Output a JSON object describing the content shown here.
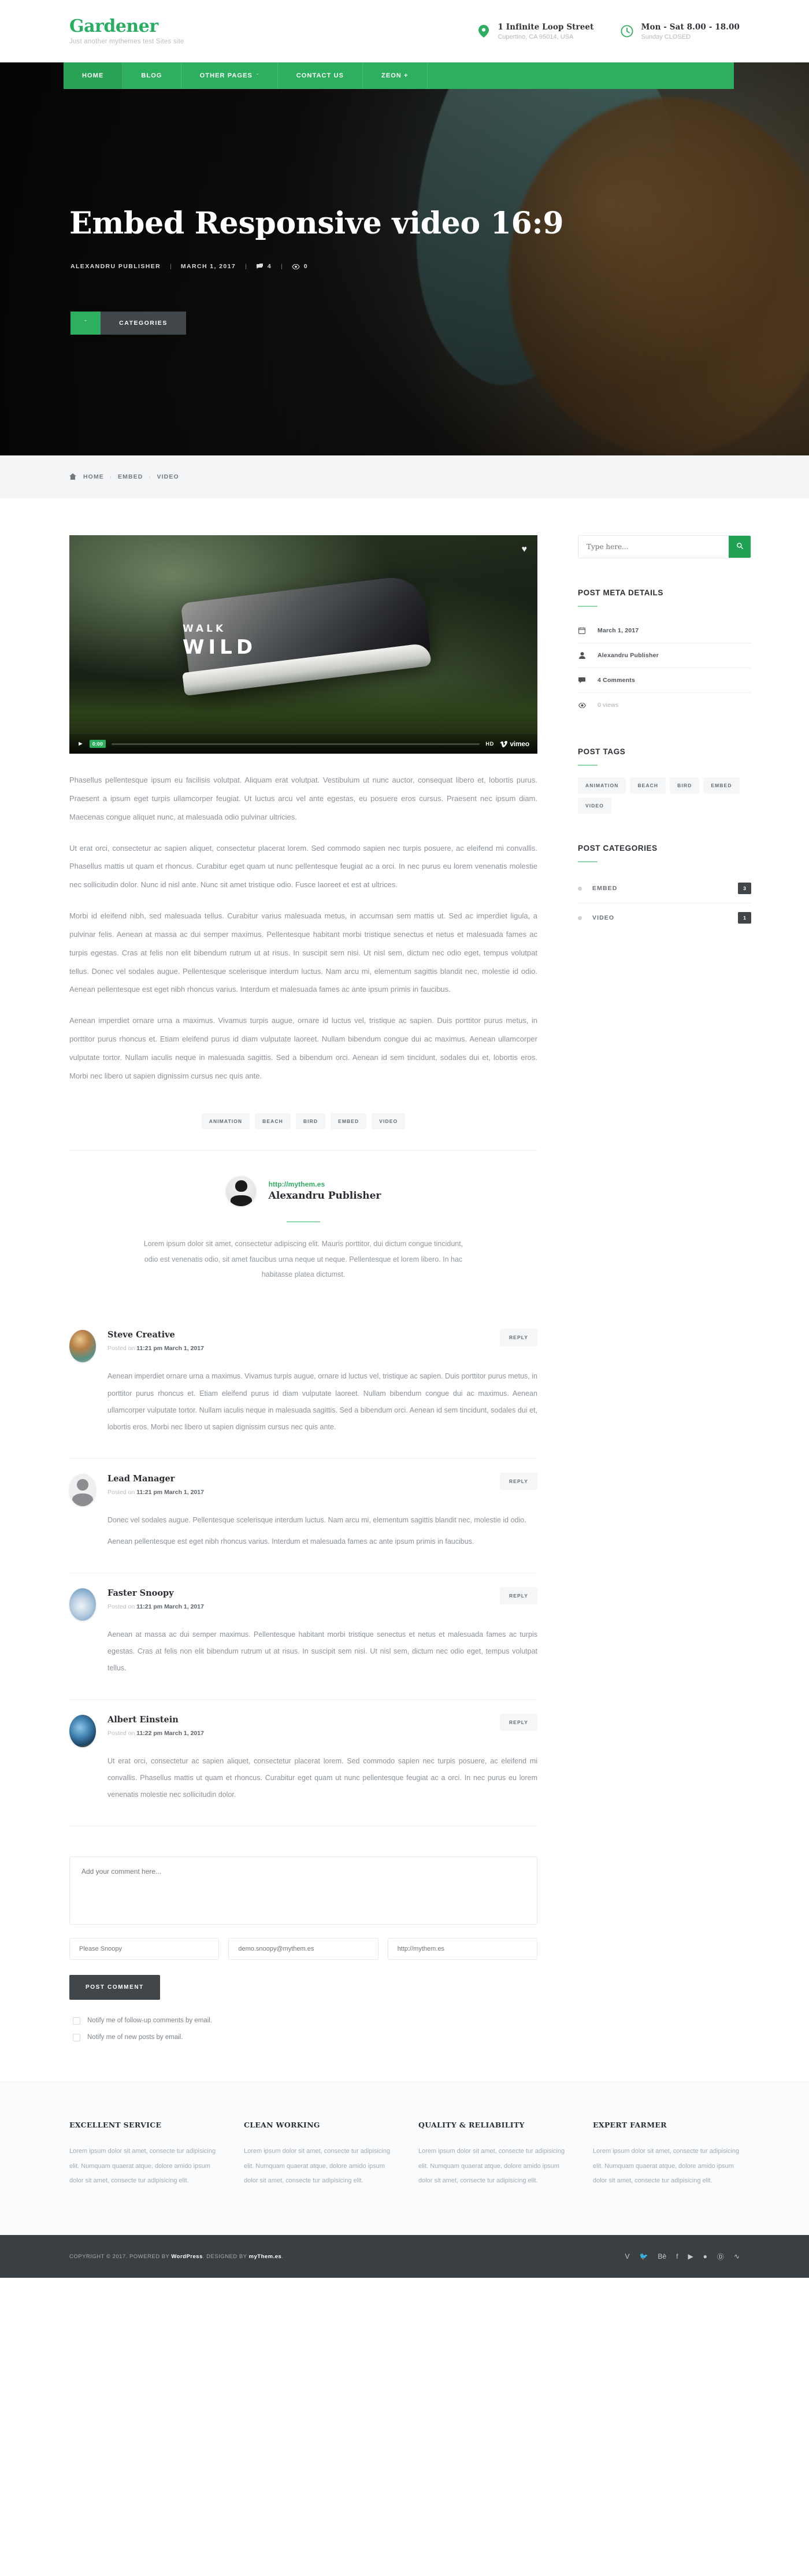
{
  "header": {
    "brand": {
      "title": "Gardener",
      "tagline": "Just another mythemes test Sites site"
    },
    "info": [
      {
        "icon": "location-pin-icon",
        "primary": "1 Infinite Loop Street",
        "secondary": "Cupertino, CA 95014, USA"
      },
      {
        "icon": "clock-icon",
        "primary": "Mon - Sat 8.00 - 18.00",
        "secondary": "Sunday CLOSED"
      }
    ]
  },
  "nav": {
    "items": [
      {
        "label": "HOME",
        "caret": ""
      },
      {
        "label": "BLOG",
        "caret": ""
      },
      {
        "label": "OTHER PAGES",
        "caret": "ˇ"
      },
      {
        "label": "CONTACT US",
        "caret": ""
      },
      {
        "label": "ZEON +",
        "caret": ""
      }
    ]
  },
  "hero": {
    "title": "Embed Responsive video 16:9",
    "meta": {
      "author": "ALEXANDRU PUBLISHER",
      "date": "MARCH 1, 2017",
      "comments": "4",
      "views": "0",
      "separator": "|"
    },
    "categories_button": {
      "label": "CATEGORIES",
      "arrow": "ˇ"
    }
  },
  "breadcrumb": {
    "home": "HOME",
    "items": [
      "EMBED",
      "VIDEO"
    ],
    "chevron": "›"
  },
  "player": {
    "watermark_line1": "WALK",
    "watermark_line2": "WILD",
    "time": "0:00",
    "quality": "HD",
    "provider": "vimeo",
    "play_icon": "play-icon",
    "favorite_icon": "heart-icon"
  },
  "article": {
    "paragraphs": [
      "Phasellus pellentesque ipsum eu facilisis volutpat. Aliquam erat volutpat. Vestibulum ut nunc auctor, consequat libero et, lobortis purus. Praesent a ipsum eget turpis ullamcorper feugiat. Ut luctus arcu vel ante egestas, eu posuere eros cursus. Praesent nec ipsum diam. Maecenas congue aliquet nunc, at malesuada odio pulvinar ultricies.",
      "Ut erat orci, consectetur ac sapien aliquet, consectetur placerat lorem. Sed commodo sapien nec turpis posuere, ac eleifend mi convallis. Phasellus mattis ut quam et rhoncus. Curabitur eget quam ut nunc pellentesque feugiat ac a orci. In nec purus eu lorem venenatis molestie nec sollicitudin dolor. Nunc id nisl ante. Nunc sit amet tristique odio. Fusce laoreet et est at ultrices.",
      "Morbi id eleifend nibh, sed malesuada tellus. Curabitur varius malesuada metus, in accumsan sem mattis ut. Sed ac imperdiet ligula, a pulvinar felis. Aenean at massa ac dui semper maximus. Pellentesque habitant morbi tristique senectus et netus et malesuada fames ac turpis egestas. Cras at felis non elit bibendum rutrum ut at risus. In suscipit sem nisi. Ut nisl sem, dictum nec odio eget, tempus volutpat tellus. Donec vel sodales augue. Pellentesque scelerisque interdum luctus. Nam arcu mi, elementum sagittis blandit nec, molestie id odio. Aenean pellentesque est eget nibh rhoncus varius. Interdum et malesuada fames ac ante ipsum primis in faucibus.",
      "Aenean imperdiet ornare urna a maximus. Vivamus turpis augue, ornare id luctus vel, tristique ac sapien. Duis porttitor purus metus, in porttitor purus rhoncus et. Etiam eleifend purus id diam vulputate laoreet. Nullam bibendum congue dui ac maximus. Aenean ullamcorper vulputate tortor. Nullam iaculis neque in malesuada sagittis. Sed a bibendum orci. Aenean id sem tincidunt, sodales dui et, lobortis eros. Morbi nec libero ut sapien dignissim cursus nec quis ante."
    ],
    "tags": [
      "ANIMATION",
      "BEACH",
      "BIRD",
      "EMBED",
      "VIDEO"
    ]
  },
  "author": {
    "url": "http://mythem.es",
    "name": "Alexandru Publisher",
    "bio": "Lorem ipsum dolor sit amet, consectetur adipiscing elit. Mauris porttitor, dui dictum congue tincidunt, odio est venenatis odio, sit amet faucibus urna neque ut neque. Pellentesque et lorem libero. In hac habitasse platea dictumst."
  },
  "comments": {
    "reply_label": "REPLY",
    "posted_prefix": "Posted on ",
    "items": [
      {
        "name": "Steve Creative",
        "date": "11:21 pm March 1, 2017",
        "avatar": "avatar-steve-creative",
        "paragraphs": [
          "Aenean imperdiet ornare urna a maximus. Vivamus turpis augue, ornare id luctus vel, tristique ac sapien. Duis porttitor purus metus, in porttitor purus rhoncus et. Etiam eleifend purus id diam vulputate laoreet. Nullam bibendum congue dui ac maximus. Aenean ullamcorper vulputate tortor. Nullam iaculis neque in malesuada sagittis. Sed a bibendum orci. Aenean id sem tincidunt, sodales dui et, lobortis eros. Morbi nec libero ut sapien dignissim cursus nec quis ante."
        ]
      },
      {
        "name": "Lead Manager",
        "date": "11:21 pm March 1, 2017",
        "avatar": "avatar-lead-manager",
        "paragraphs": [
          "Donec vel sodales augue. Pellentesque scelerisque interdum luctus. Nam arcu mi, elementum sagittis blandit nec, molestie id odio.",
          "Aenean pellentesque est eget nibh rhoncus varius. Interdum et malesuada fames ac ante ipsum primis in faucibus."
        ]
      },
      {
        "name": "Faster Snoopy",
        "date": "11:21 pm March 1, 2017",
        "avatar": "avatar-faster-snoopy",
        "paragraphs": [
          "Aenean at massa ac dui semper maximus. Pellentesque habitant morbi tristique senectus et netus et malesuada fames ac turpis egestas. Cras at felis non elit bibendum rutrum ut at risus. In suscipit sem nisi. Ut nisl sem, dictum nec odio eget, tempus volutpat tellus."
        ]
      },
      {
        "name": "Albert Einstein",
        "date": "11:22 pm March 1, 2017",
        "avatar": "avatar-albert-einstein",
        "paragraphs": [
          "Ut erat orci, consectetur ac sapien aliquet, consectetur placerat lorem. Sed commodo sapien nec turpis posuere, ac eleifend mi convallis. Phasellus mattis ut quam et rhoncus. Curabitur eget quam ut nunc pellentesque feugiat ac a orci. In nec purus eu lorem venenatis molestie nec sollicitudin dolor."
        ]
      }
    ]
  },
  "comment_form": {
    "comment_placeholder": "Add your comment here...",
    "name_placeholder": "Please Snoopy",
    "email_placeholder": "demo.snoopy@mythem.es",
    "website_placeholder": "http://mythem.es",
    "submit_label": "POST COMMENT",
    "checkbox_followup": "Notify me of follow-up comments by email.",
    "checkbox_newposts": "Notify me of new posts by email."
  },
  "sidebar": {
    "search": {
      "placeholder": "Type here...",
      "icon": "search-icon"
    },
    "post_meta": {
      "title": "POST META DETAILS",
      "items": [
        {
          "icon": "calendar-icon",
          "label": "March 1, 2017",
          "muted": false
        },
        {
          "icon": "user-icon",
          "label": "Alexandru Publisher",
          "muted": false
        },
        {
          "icon": "comment-icon",
          "label": "4 Comments",
          "muted": false
        },
        {
          "icon": "eye-icon",
          "label": "0 views",
          "muted": true
        }
      ]
    },
    "post_tags": {
      "title": "POST TAGS",
      "tags": [
        "ANIMATION",
        "BEACH",
        "BIRD",
        "EMBED",
        "VIDEO"
      ]
    },
    "post_categories": {
      "title": "POST CATEGORIES",
      "items": [
        {
          "name": "EMBED",
          "count": "3"
        },
        {
          "name": "VIDEO",
          "count": "1"
        }
      ]
    }
  },
  "footer": {
    "columns": [
      {
        "title": "EXCELLENT SERVICE",
        "text": "Lorem ipsum dolor sit amet, consecte tur adipisicing elit. Numquam quaerat atque, dolore amido ipsum dolor sit amet, consecte tur adipisicing elit."
      },
      {
        "title": "CLEAN WORKING",
        "text": "Lorem ipsum dolor sit amet, consecte tur adipisicing elit. Numquam quaerat atque, dolore amido ipsum dolor sit amet, consecte tur adipisicing elit."
      },
      {
        "title": "QUALITY & RELIABILITY",
        "text": "Lorem ipsum dolor sit amet, consecte tur adipisicing elit. Numquam quaerat atque, dolore amido ipsum dolor sit amet, consecte tur adipisicing elit."
      },
      {
        "title": "EXPERT FARMER",
        "text": "Lorem ipsum dolor sit amet, consecte tur adipisicing elit. Numquam quaerat atque, dolore amido ipsum dolor sit amet, consecte tur adipisicing elit."
      }
    ],
    "copyright_pre": "COPYRIGHT © 2017. POWERED BY ",
    "copyright_wp": "WordPress",
    "copyright_mid": ". DESIGNED BY ",
    "copyright_brand": "myThem.es",
    "copyright_end": ".",
    "social": [
      "vimeo-icon",
      "twitter-icon",
      "behance-icon",
      "facebook-icon",
      "youtube-icon",
      "dribbble-icon",
      "pinterest-icon",
      "rss-icon"
    ]
  },
  "colors": {
    "accent": "#2eaf5f",
    "dark": "#41464b",
    "text": "#8d929a"
  }
}
